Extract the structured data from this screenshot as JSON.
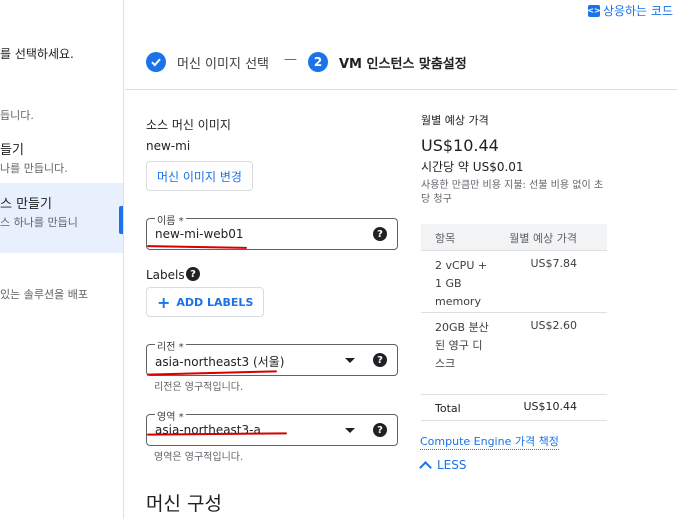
{
  "top_link": {
    "label": "상응하는 코드"
  },
  "sidebar": {
    "line1": "를 선택하세요.",
    "line2": "듭니다.",
    "item1_title": "들기",
    "item1_sub": "나를 만듭니다.",
    "item2_title": "스 만들기",
    "item2_sub": "스 하나를 만듭니",
    "line3": "있는 솔루션을 배포"
  },
  "stepper": {
    "step1_label": "머신 이미지 선택",
    "separator": "—",
    "step2_number": "2",
    "step2_label": "VM 인스턴스 맞춤설정"
  },
  "form": {
    "source_label": "소스 머신 이미지",
    "source_value": "new-mi",
    "change_button": "머신 이미지 변경",
    "name_label": "이름 *",
    "name_value": "new-mi-web01",
    "labels_heading": "Labels",
    "add_labels_button": "ADD LABELS",
    "region_label": "리전 *",
    "region_value": "asia-northeast3 (서울)",
    "region_hint": "리전은 영구적입니다.",
    "zone_label": "영역 *",
    "zone_value": "asia-northeast3-a",
    "zone_hint": "영역은 영구적입니다.",
    "machine_config_title": "머신 구성"
  },
  "cost": {
    "title": "월별 예상 가격",
    "monthly": "US$10.44",
    "hourly": "시간당 약 US$0.01",
    "description": "사용한 만큼만 비용 지불: 선불 비용 없이 초당 청구",
    "table_headers": [
      "항목",
      "월별 예상 가격"
    ],
    "rows": [
      {
        "item": "2 vCPU + 1 GB memory",
        "price": "US$7.84"
      },
      {
        "item": "20GB 분산된 영구 디스크",
        "price": "US$2.60"
      }
    ],
    "total_label": "Total",
    "total_value": "US$10.44",
    "pricing_link": "Compute Engine 가격 책정",
    "less_button": "LESS"
  },
  "colors": {
    "accent": "#1a73e8",
    "annotation": "#d50000"
  }
}
